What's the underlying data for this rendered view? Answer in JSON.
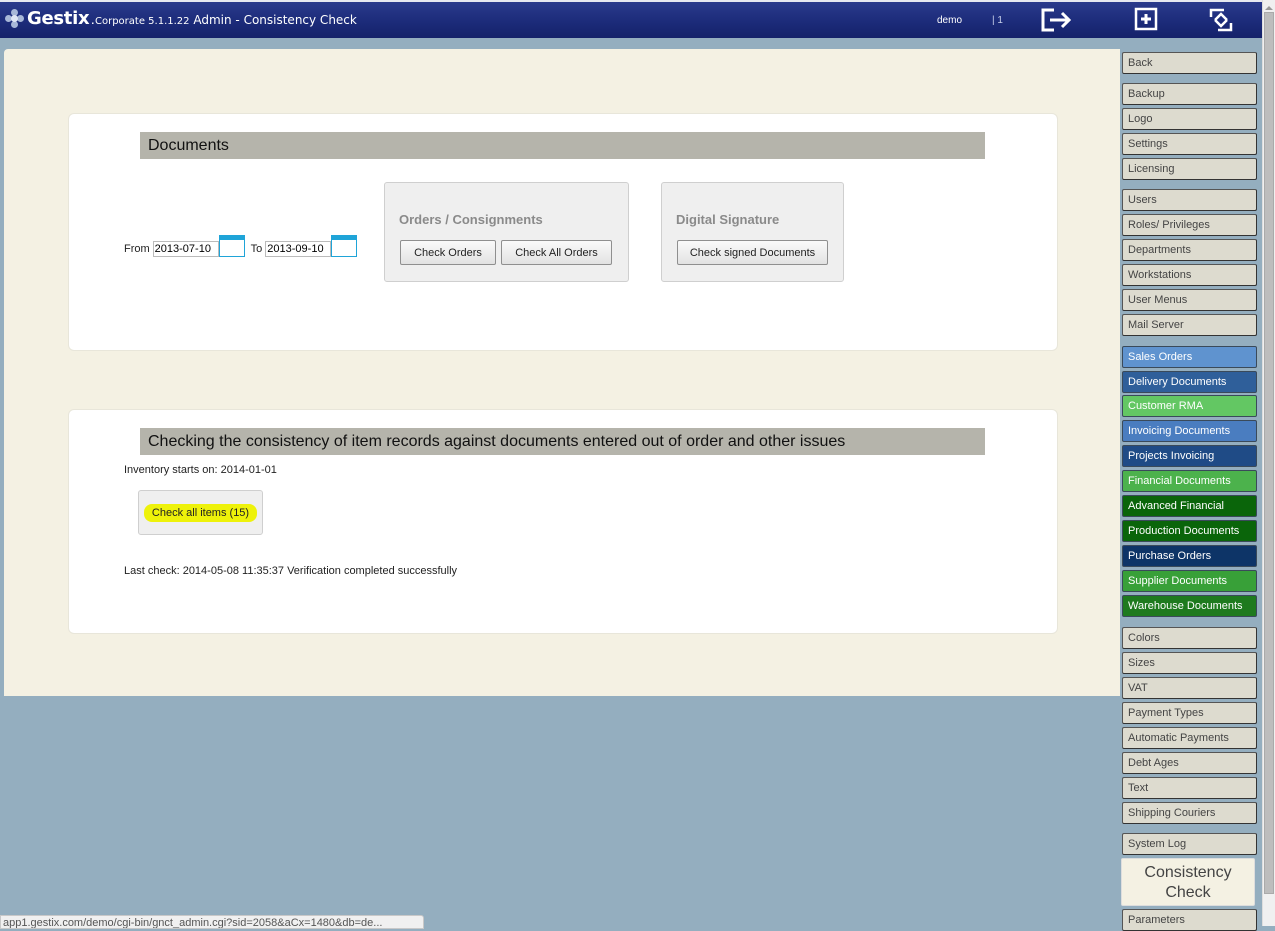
{
  "header": {
    "logo_text": "Gestix",
    "edition": "Corporate 5.1.1.22",
    "title": "Admin - Consistency Check",
    "user": "demo",
    "session": "| 1",
    "icons": [
      "logout-icon",
      "new-window-icon",
      "refresh-icon"
    ]
  },
  "documents_section": {
    "title": "Documents",
    "from_label": "From",
    "from_value": "2013-07-10",
    "to_label": "To",
    "to_value": "2013-09-10",
    "orders_group": {
      "title": "Orders / Consignments",
      "check_orders": "Check Orders",
      "check_all_orders": "Check All Orders"
    },
    "signature_group": {
      "title": "Digital Signature",
      "check_signed": "Check signed Documents"
    }
  },
  "items_section": {
    "title": "Checking the consistency of item records against documents entered out of order and other issues",
    "inventory_start": "Inventory starts on: 2014-01-01",
    "check_all_items": "Check all items (15)",
    "last_check": "Last check: 2014-05-08 11:35:37 Verification completed successfully"
  },
  "sidebar": {
    "items": [
      {
        "label": "Back",
        "color": "#dddbcf"
      },
      {
        "label": "Backup",
        "color": "#dddbcf"
      },
      {
        "label": "Logo",
        "color": "#dddbcf"
      },
      {
        "label": "Settings",
        "color": "#dddbcf"
      },
      {
        "label": "Licensing",
        "color": "#dddbcf"
      },
      {
        "label": "Users",
        "color": "#dddbcf"
      },
      {
        "label": "Roles/ Privileges",
        "color": "#dddbcf"
      },
      {
        "label": "Departments",
        "color": "#dddbcf"
      },
      {
        "label": "Workstations",
        "color": "#dddbcf"
      },
      {
        "label": "User Menus",
        "color": "#dddbcf"
      },
      {
        "label": "Mail Server",
        "color": "#dddbcf"
      },
      {
        "label": "Sales Orders",
        "color": "#5f93cf"
      },
      {
        "label": "Delivery Documents",
        "color": "#2f5f9a"
      },
      {
        "label": "Customer RMA",
        "color": "#63c763"
      },
      {
        "label": "Invoicing Documents",
        "color": "#4a7dc0"
      },
      {
        "label": "Projects Invoicing",
        "color": "#1f4b86"
      },
      {
        "label": "Financial Documents",
        "color": "#4cb24c"
      },
      {
        "label": "Advanced Financial",
        "color": "#0a650a"
      },
      {
        "label": "Production Documents",
        "color": "#0a650a"
      },
      {
        "label": "Purchase Orders",
        "color": "#0d3467"
      },
      {
        "label": "Supplier Documents",
        "color": "#38a038"
      },
      {
        "label": "Warehouse Documents",
        "color": "#1e7a1e"
      },
      {
        "label": "Colors",
        "color": "#dddbcf"
      },
      {
        "label": "Sizes",
        "color": "#dddbcf"
      },
      {
        "label": "VAT",
        "color": "#dddbcf"
      },
      {
        "label": "Payment Types",
        "color": "#dddbcf"
      },
      {
        "label": "Automatic Payments",
        "color": "#dddbcf"
      },
      {
        "label": "Debt Ages",
        "color": "#dddbcf"
      },
      {
        "label": "Text",
        "color": "#dddbcf"
      },
      {
        "label": "Shipping Couriers",
        "color": "#dddbcf"
      },
      {
        "label": "System Log",
        "color": "#dddbcf"
      },
      {
        "label": "Consistency Check",
        "color": "#f4f1e3",
        "active": true
      },
      {
        "label": "Parameters",
        "color": "#dddbcf"
      }
    ]
  },
  "statusbar": {
    "url": "app1.gestix.com/demo/cgi-bin/gnct_admin.cgi?sid=2058&aCx=1480&db=de..."
  }
}
